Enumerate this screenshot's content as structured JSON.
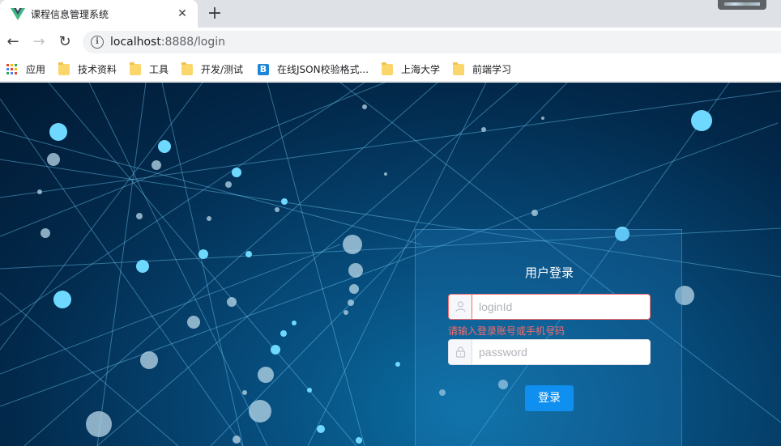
{
  "browser": {
    "tab": {
      "title": "课程信息管理系统",
      "favicon": "vue-logo-icon",
      "close_glyph": "✕"
    },
    "new_tab_glyph": "+",
    "nav": {
      "back_glyph": "←",
      "forward_glyph": "→",
      "reload_glyph": "↻"
    },
    "omnibox": {
      "host": "localhost",
      "port_path": ":8888/login",
      "info_glyph": "i"
    },
    "bookmarks": [
      {
        "label": "应用",
        "icon": "apps-grid-icon"
      },
      {
        "label": "技术资料",
        "icon": "folder-icon"
      },
      {
        "label": "工具",
        "icon": "folder-icon"
      },
      {
        "label": "开发/测试",
        "icon": "folder-icon"
      },
      {
        "label": "在线JSON校验格式...",
        "icon": "bejson-icon",
        "icon_text": "B"
      },
      {
        "label": "上海大学",
        "icon": "folder-icon"
      },
      {
        "label": "前端学习",
        "icon": "folder-icon"
      }
    ]
  },
  "login": {
    "title": "用户登录",
    "login_id": {
      "value": "",
      "placeholder": "loginId",
      "icon": "user-icon"
    },
    "error_message": "请输入登录账号或手机号码",
    "password": {
      "value": "",
      "placeholder": "password",
      "icon": "lock-icon"
    },
    "submit_label": "登录"
  },
  "colors": {
    "page_background": "#02284a",
    "button_primary": "#0f8ff0",
    "error": "#f56c6c",
    "node_glow": "#6fd8ff"
  }
}
